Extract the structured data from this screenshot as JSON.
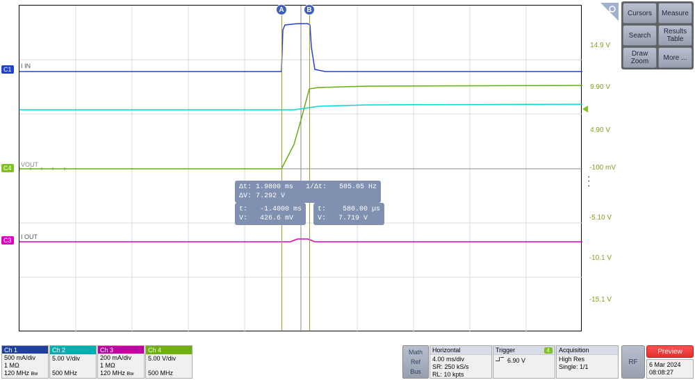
{
  "channels": {
    "c1": {
      "id": "C1",
      "name": "I IN",
      "scale": "500 mA/div",
      "impedance": "1 MΩ",
      "bw": "120 MHz",
      "bw_suffix": "Bw"
    },
    "c2": {
      "id": "Ch 2",
      "scale": "5.00 V/div",
      "impedance": "",
      "bw": "500 MHz"
    },
    "c3": {
      "id": "C3",
      "name": "I OUT",
      "header": "Ch 3",
      "scale": "200 mA/div",
      "impedance": "1 MΩ",
      "bw": "120 MHz",
      "bw_suffix": "Bw"
    },
    "c4": {
      "id": "C4",
      "name": "VOUT",
      "header": "Ch 4",
      "scale": "5.00 V/div",
      "impedance": "",
      "bw": "500 MHz"
    }
  },
  "cursors": {
    "a": {
      "label": "A",
      "t": "-1.4000 ms",
      "v": "426.6 mV"
    },
    "b": {
      "label": "B",
      "t": "580.00 µs",
      "v": "7.719 V"
    },
    "delta": {
      "dt": "1.9800 ms",
      "inv_dt": "505.05 Hz",
      "dv": "7.292 V"
    }
  },
  "ylabels": [
    "14.9 V",
    "9.90 V",
    "4.90 V",
    "-100 mV",
    "-5.10 V",
    "-10.1 V",
    "-15.1 V"
  ],
  "horizontal": {
    "title": "Horizontal",
    "scale": "4.00 ms/div",
    "sr": "SR: 250 kS/s",
    "rl": "RL: 10 kpts"
  },
  "trigger": {
    "title": "Trigger",
    "badge": "4",
    "level": "6.90 V"
  },
  "acquisition": {
    "title": "Acquisition",
    "mode": "High Res",
    "status": "Single: 1/1"
  },
  "buttons": {
    "cursors": "Cursors",
    "measure": "Measure",
    "search": "Search",
    "results": "Results\nTable",
    "draw": "Draw\nZoom",
    "more": "More ...",
    "math": "Math",
    "ref": "Ref",
    "bus": "Bus",
    "rf": "RF",
    "preview": "Preview"
  },
  "datetime": {
    "date": "6 Mar 2024",
    "time": "08:08:27"
  },
  "chart_data": {
    "type": "line",
    "title": "",
    "x_unit": "ms",
    "x_range": [
      -20,
      20
    ],
    "x_div": 4.0,
    "y_unit_c4": "V",
    "y_range_c4": [
      -15.1,
      14.9
    ],
    "y_div_c4": 5.0,
    "cursors": {
      "A_ms": -1.4,
      "B_ms": 0.58
    },
    "series": [
      {
        "name": "C1 I IN",
        "color": "#2040d0",
        "unit": "mA",
        "scale_per_div": 500,
        "notes": "flat ~0 with pulse up ~0.9 div between cursors"
      },
      {
        "name": "C2",
        "color": "#00d0d0",
        "unit": "V",
        "scale_per_div": 5.0,
        "notes": "flat ~8 V, small rise ~0.3 V after t=0"
      },
      {
        "name": "C3 I OUT",
        "color": "#e000c0",
        "unit": "mA",
        "scale_per_div": 200,
        "notes": "flat ~0 with small bump at pulse"
      },
      {
        "name": "C4 VOUT",
        "color": "#80c020",
        "unit": "V",
        "scale_per_div": 5.0,
        "values_at_cursors": {
          "A": 0.4266,
          "B": 7.719
        },
        "notes": "0 V before, ramps to ~7.7 V between cursors, settles ~7.8 V"
      }
    ]
  }
}
